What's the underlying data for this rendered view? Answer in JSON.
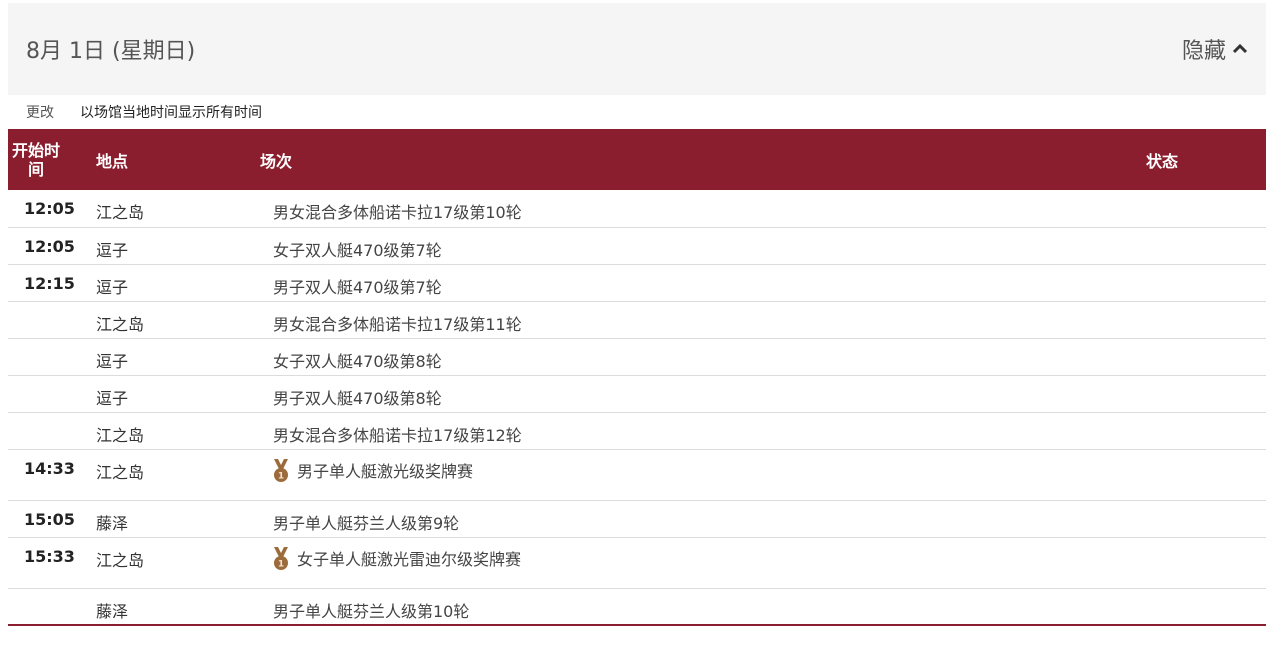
{
  "day": {
    "title": "8月 1日 (星期日)",
    "toggle_label": "隐藏"
  },
  "timezone": {
    "change_label": "更改",
    "text": "以场馆当地时间显示所有时间"
  },
  "table": {
    "headers": {
      "time": "开始时间",
      "venue": "地点",
      "event": "场次",
      "status": "状态"
    },
    "rows": [
      {
        "time": "12:05",
        "venue": "江之岛",
        "event": "男女混合多体船诺卡拉17级第10轮",
        "medal": false
      },
      {
        "time": "12:05",
        "venue": "逗子",
        "event": "女子双人艇470级第7轮",
        "medal": false
      },
      {
        "time": "12:15",
        "venue": "逗子",
        "event": "男子双人艇470级第7轮",
        "medal": false
      },
      {
        "time": "",
        "venue": "江之岛",
        "event": "男女混合多体船诺卡拉17级第11轮",
        "medal": false
      },
      {
        "time": "",
        "venue": "逗子",
        "event": "女子双人艇470级第8轮",
        "medal": false
      },
      {
        "time": "",
        "venue": "逗子",
        "event": "男子双人艇470级第8轮",
        "medal": false
      },
      {
        "time": "",
        "venue": "江之岛",
        "event": "男女混合多体船诺卡拉17级第12轮",
        "medal": false
      },
      {
        "time": "14:33",
        "venue": "江之岛",
        "event": "男子单人艇激光级奖牌赛",
        "medal": true
      },
      {
        "time": "15:05",
        "venue": "藤泽",
        "event": "男子单人艇芬兰人级第9轮",
        "medal": false
      },
      {
        "time": "15:33",
        "venue": "江之岛",
        "event": "女子单人艇激光雷迪尔级奖牌赛",
        "medal": true
      },
      {
        "time": "",
        "venue": "藤泽",
        "event": "男子单人艇芬兰人级第10轮",
        "medal": false
      }
    ]
  },
  "colors": {
    "header_bg": "#8a1e2e",
    "medal_bronze": "#9c6b3c",
    "day_bg": "#f5f5f6"
  },
  "icons": {
    "toggle": "chevron-up-icon",
    "medal": "medal-icon"
  }
}
